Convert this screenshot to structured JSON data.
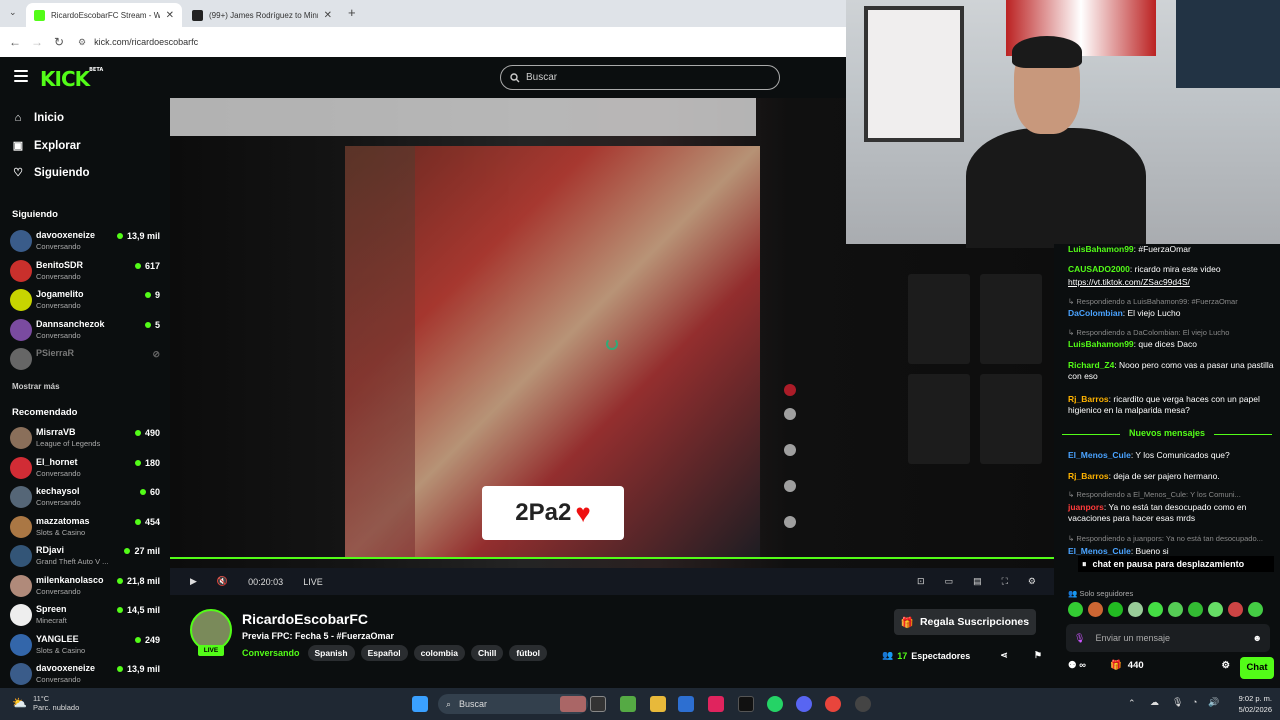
{
  "browser": {
    "tabs": [
      {
        "title": "RicardoEscobarFC Stream - Wa",
        "active": true
      },
      {
        "title": "(99+) James Rodríguez to Minne",
        "active": false
      }
    ],
    "url": "kick.com/ricardoescobarfc"
  },
  "header": {
    "logo": "KICK",
    "logo_badge": "BETA",
    "search_placeholder": "Buscar"
  },
  "sidebar": {
    "nav": [
      {
        "label": "Inicio",
        "icon": "home-icon"
      },
      {
        "label": "Explorar",
        "icon": "compass-icon"
      },
      {
        "label": "Siguiendo",
        "icon": "heart-icon"
      }
    ],
    "following_title": "Siguiendo",
    "following": [
      {
        "name": "davooxeneize",
        "category": "Conversando",
        "viewers": "13,9 mil",
        "live": true,
        "color": "#3a5c8a"
      },
      {
        "name": "BenitoSDR",
        "category": "Conversando",
        "viewers": "617",
        "live": true,
        "color": "#c9302c"
      },
      {
        "name": "Jogamelito",
        "category": "Conversando",
        "viewers": "9",
        "live": true,
        "color": "#c7d400"
      },
      {
        "name": "Dannsanchezok",
        "category": "Conversando",
        "viewers": "5",
        "live": true,
        "color": "#7a4ba0"
      },
      {
        "name": "PSierraR",
        "category": "",
        "viewers": "",
        "live": false,
        "color": "#666666"
      }
    ],
    "show_more": "Mostrar más",
    "recommended_title": "Recomendado",
    "recommended": [
      {
        "name": "MisrraVB",
        "category": "League of Legends",
        "viewers": "490",
        "color": "#8a6f5a"
      },
      {
        "name": "El_hornet",
        "category": "Conversando",
        "viewers": "180",
        "color": "#d12c35"
      },
      {
        "name": "kechaysol",
        "category": "Conversando",
        "viewers": "60",
        "color": "#556677"
      },
      {
        "name": "mazzatomas",
        "category": "Slots & Casino",
        "viewers": "454",
        "color": "#aa7744"
      },
      {
        "name": "RDjavi",
        "category": "Grand Theft Auto V ...",
        "viewers": "27 mil",
        "color": "#335577"
      },
      {
        "name": "milenkanolasco",
        "category": "Conversando",
        "viewers": "21,8 mil",
        "color": "#b08a7a"
      },
      {
        "name": "Spreen",
        "category": "Minecraft",
        "viewers": "14,5 mil",
        "color": "#eeeeee"
      },
      {
        "name": "YANGLEE",
        "category": "Slots & Casino",
        "viewers": "249",
        "color": "#3366aa"
      },
      {
        "name": "davooxeneize",
        "category": "Conversando",
        "viewers": "13,9 mil",
        "color": "#3a5c8a"
      }
    ]
  },
  "player": {
    "time": "00:20:03",
    "live_label": "LIVE",
    "overlay_text": "2Pa2"
  },
  "stream": {
    "streamer": "RicardoEscobarFC",
    "live_badge": "LIVE",
    "title": "Previa FPC: Fecha 5 - #FuerzaOmar",
    "category": "Conversando",
    "tags": [
      "Spanish",
      "Español",
      "colombia",
      "Chill",
      "fútbol"
    ],
    "gift_button": "Regala Suscripciones",
    "viewers_count": "17",
    "viewers_label": "Espectadores"
  },
  "chat": {
    "messages": [
      {
        "user": "LuisBahamon99",
        "color": "#53fc18",
        "text": ": #FuerzaOmar"
      },
      {
        "user": "CAUSADO2000",
        "color": "#53fc18",
        "text": ": ricardo mira este video"
      },
      {
        "user": "",
        "color": "#ffffff",
        "text": "https://vt.tiktok.com/ZSac99d4S/"
      },
      {
        "reply": "Respondiendo a LuisBahamon99: #FuerzaOmar"
      },
      {
        "user": "DaColombian",
        "color": "#4aa3ff",
        "text": ": El viejo Lucho"
      },
      {
        "reply": "Respondiendo a DaColombian: El viejo Lucho"
      },
      {
        "user": "LuisBahamon99",
        "color": "#53fc18",
        "text": ": que dices Daco"
      },
      {
        "user": "Richard_Z4",
        "color": "#53fc18",
        "text": ": Nooo pero como vas a pasar una pastilla con eso"
      },
      {
        "user": "Rj_Barros",
        "color": "#ffb300",
        "text": ": ricardito que verga haces con un papel higienico en la malparida mesa?"
      }
    ],
    "new_messages": "Nuevos mensajes",
    "messages2": [
      {
        "user": "El_Menos_Cule",
        "color": "#4aa3ff",
        "text": ": Y los Comunicados que?"
      },
      {
        "user": "Rj_Barros",
        "color": "#ffb300",
        "text": ": deja de ser pajero hermano."
      },
      {
        "reply": "Respondiendo a El_Menos_Cule: Y los Comuni..."
      },
      {
        "user": "juanpors",
        "color": "#ff3b3b",
        "text": ": Ya no está tan desocupado como en vacaciones para hacer esas mrds"
      },
      {
        "reply": "Respondiendo a juanpors: Ya no está tan desocupado..."
      },
      {
        "user": "El_Menos_Cule",
        "color": "#4aa3ff",
        "text": ": Bueno si"
      }
    ],
    "paused": "chat en pausa para desplazamiento",
    "followers_only": "Solo seguidores",
    "input_placeholder": "Enviar un mensaje",
    "points": "440",
    "send_button": "Chat"
  },
  "taskbar": {
    "temp": "11°C",
    "weather": "Parc. nublado",
    "search": "Buscar",
    "time": "9:02 p. m.",
    "date": "5/02/2026"
  }
}
